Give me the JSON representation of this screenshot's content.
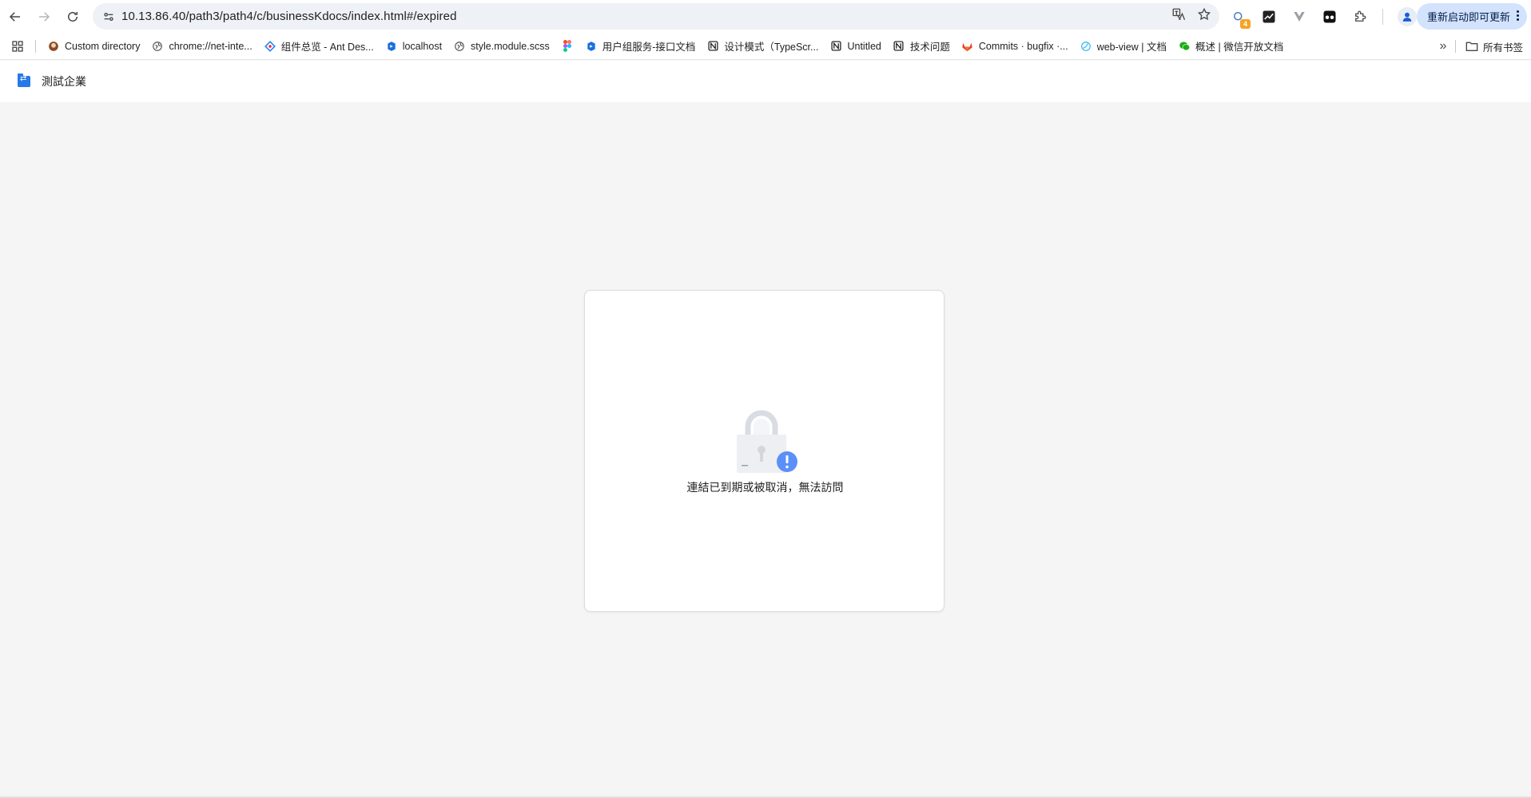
{
  "browser": {
    "url": "10.13.86.40/path3/path4/c/businessKdocs/index.html#/expired",
    "update_label": "重新启动即可更新",
    "extension_badge": "4"
  },
  "bookmarks": {
    "items": [
      {
        "label": "Custom directory",
        "icon": "custom-icon"
      },
      {
        "label": "chrome://net-inte...",
        "icon": "globe-icon"
      },
      {
        "label": "组件总览 - Ant Des...",
        "icon": "ant-design-icon"
      },
      {
        "label": "localhost",
        "icon": "localhost-icon"
      },
      {
        "label": "style.module.scss",
        "icon": "globe-icon"
      },
      {
        "label": "",
        "icon": "figma-icon"
      },
      {
        "label": "用户组服务-接口文档",
        "icon": "docs-icon"
      },
      {
        "label": "设计模式（TypeScr...",
        "icon": "notion-icon"
      },
      {
        "label": "Untitled",
        "icon": "notion-icon"
      },
      {
        "label": "技术问题",
        "icon": "notion-icon"
      },
      {
        "label": "Commits · bugfix ·...",
        "icon": "gitlab-icon"
      },
      {
        "label": "web-view | 文档",
        "icon": "webview-icon"
      },
      {
        "label": "概述 | 微信开放文档",
        "icon": "wechat-icon"
      }
    ],
    "all_bookmarks_label": "所有书签"
  },
  "app": {
    "title": "測試企業"
  },
  "card": {
    "message": "連結已到期或被取消，無法訪問"
  },
  "colors": {
    "accent": "#2878e6",
    "badge": "#5b8ff9",
    "page_bg": "#f5f5f5"
  }
}
